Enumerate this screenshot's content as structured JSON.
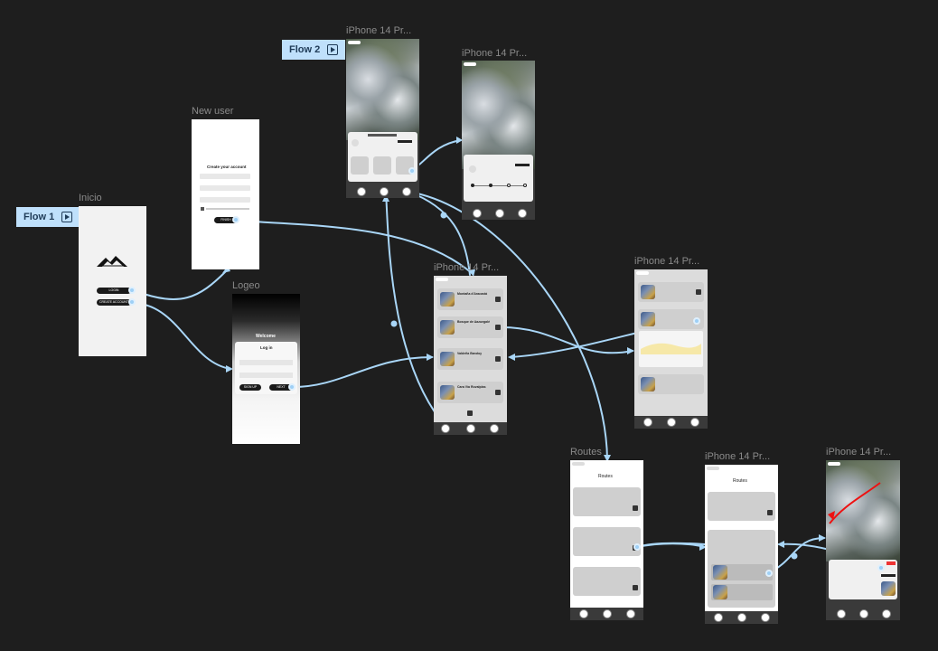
{
  "flows": {
    "flow1": "Flow 1",
    "flow2": "Flow 2"
  },
  "frames": {
    "inicio": {
      "label": "Inicio",
      "login_button": "LOGIN",
      "create_account_button": "CREATE ACCOUNT"
    },
    "new_user": {
      "label": "New user",
      "heading": "Create your account",
      "finish_button": "FINISH"
    },
    "logeo": {
      "label": "Logeo",
      "welcome": "Welcome",
      "login_title": "Log in",
      "signup_button": "SIGN UP",
      "next_button": "NEXT"
    },
    "iphone_map1": {
      "label": "iPhone 14 Pr..."
    },
    "iphone_map2": {
      "label": "iPhone 14 Pr..."
    },
    "iphone_list": {
      "label": "iPhone 14 Pr...",
      "items": [
        "Montaña d'Aracastá",
        "Bosque de Aazuegalé",
        "Valdeña Bandoy",
        "Cara Vía Ruvalplas"
      ]
    },
    "iphone_detail": {
      "label": "iPhone 14 Pr..."
    },
    "routes": {
      "label": "Routes",
      "title": "Routes"
    },
    "iphone_routes2": {
      "label": "iPhone 14 Pr...",
      "title": "Routes"
    },
    "iphone_map3": {
      "label": "iPhone 14 Pr..."
    }
  },
  "colors": {
    "canvas": "#1e1e1e",
    "connector": "#a9d6f7",
    "flow_badge": "#bfe0fb"
  }
}
